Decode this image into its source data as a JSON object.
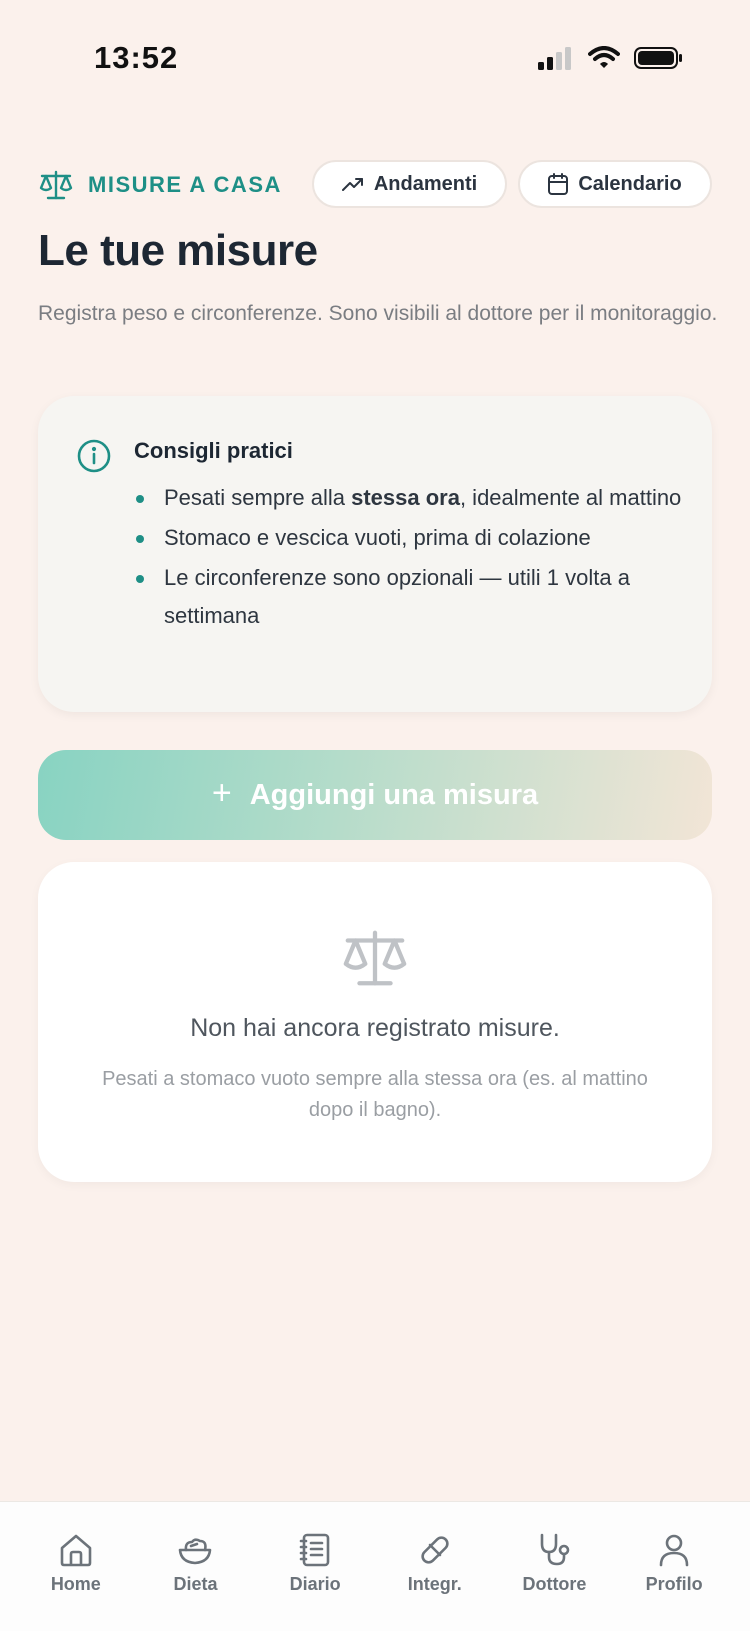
{
  "status_bar": {
    "time": "13:52"
  },
  "header": {
    "section_label": "MISURE A CASA",
    "trends_label": "Andamenti",
    "calendar_label": "Calendario"
  },
  "page": {
    "title": "Le tue misure",
    "subtitle": "Registra peso e circonferenze. Sono visibili al dottore per il monitoraggio."
  },
  "tips": {
    "title": "Consigli pratici",
    "items": [
      {
        "before": "Pesati sempre alla ",
        "bold": "stessa ora",
        "after": ", idealmente al mattino"
      },
      {
        "before": "Stomaco e vescica vuoti, prima di colazione",
        "bold": "",
        "after": ""
      },
      {
        "before": "Le circonferenze sono opzionali — utili 1 volta a settimana",
        "bold": "",
        "after": ""
      }
    ]
  },
  "add_button": {
    "label": "Aggiungi una misura"
  },
  "empty_state": {
    "title": "Non hai ancora registrato misure.",
    "subtitle": "Pesati a stomaco vuoto sempre alla stessa ora (es. al mattino dopo il bagno)."
  },
  "tab_bar": {
    "items": [
      {
        "label": "Home",
        "icon": "home-icon"
      },
      {
        "label": "Dieta",
        "icon": "salad-bowl-icon"
      },
      {
        "label": "Diario",
        "icon": "notebook-icon"
      },
      {
        "label": "Integr.",
        "icon": "pill-icon"
      },
      {
        "label": "Dottore",
        "icon": "stethoscope-icon"
      },
      {
        "label": "Profilo",
        "icon": "user-icon"
      }
    ]
  },
  "colors": {
    "background": "#fbf1ec",
    "accent": "#1e8f86",
    "button_gradient_start": "#88d3c2",
    "button_gradient_end": "#f2e5d6"
  }
}
